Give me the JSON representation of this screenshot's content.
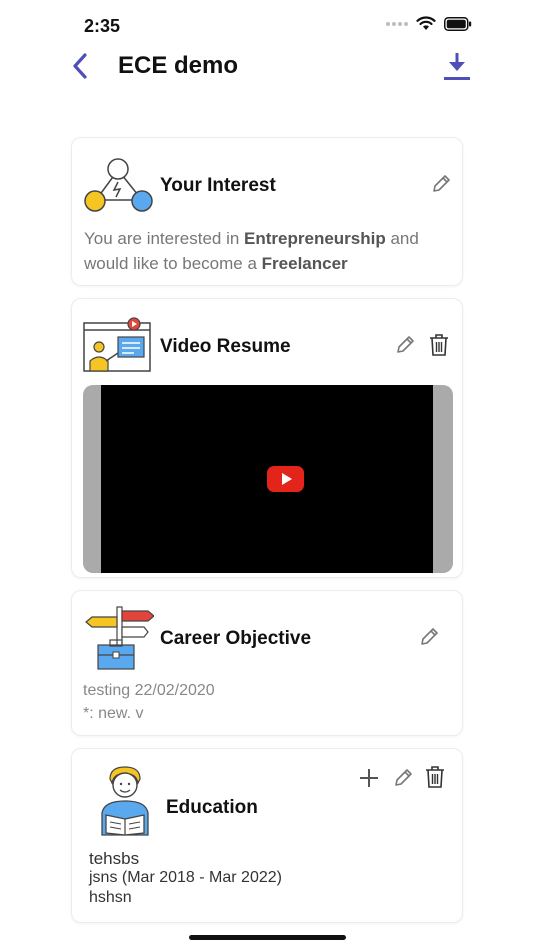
{
  "status_bar": {
    "time": "2:35"
  },
  "nav": {
    "title": "ECE demo"
  },
  "colors": {
    "accent": "#4f4fb8",
    "video_play": "#e3241b"
  },
  "interest_card": {
    "title": "Your Interest",
    "text_prefix": "You are interested in ",
    "interest": "Entrepreneurship",
    "text_middle": " and would like to become a ",
    "role": "Freelancer"
  },
  "video_card": {
    "title": "Video Resume"
  },
  "career_card": {
    "title": "Career Objective",
    "line1": "testing 22/02/2020",
    "line2": "*: new. v"
  },
  "education_card": {
    "title": "Education",
    "degree": "tehsbs",
    "institution_dates": "jsns (Mar 2018 - Mar 2022)",
    "extra": "hshsn"
  },
  "icons": {
    "back": "chevron-left-icon",
    "download": "download-icon",
    "edit": "pencil-icon",
    "delete": "trash-icon",
    "add": "plus-icon"
  }
}
